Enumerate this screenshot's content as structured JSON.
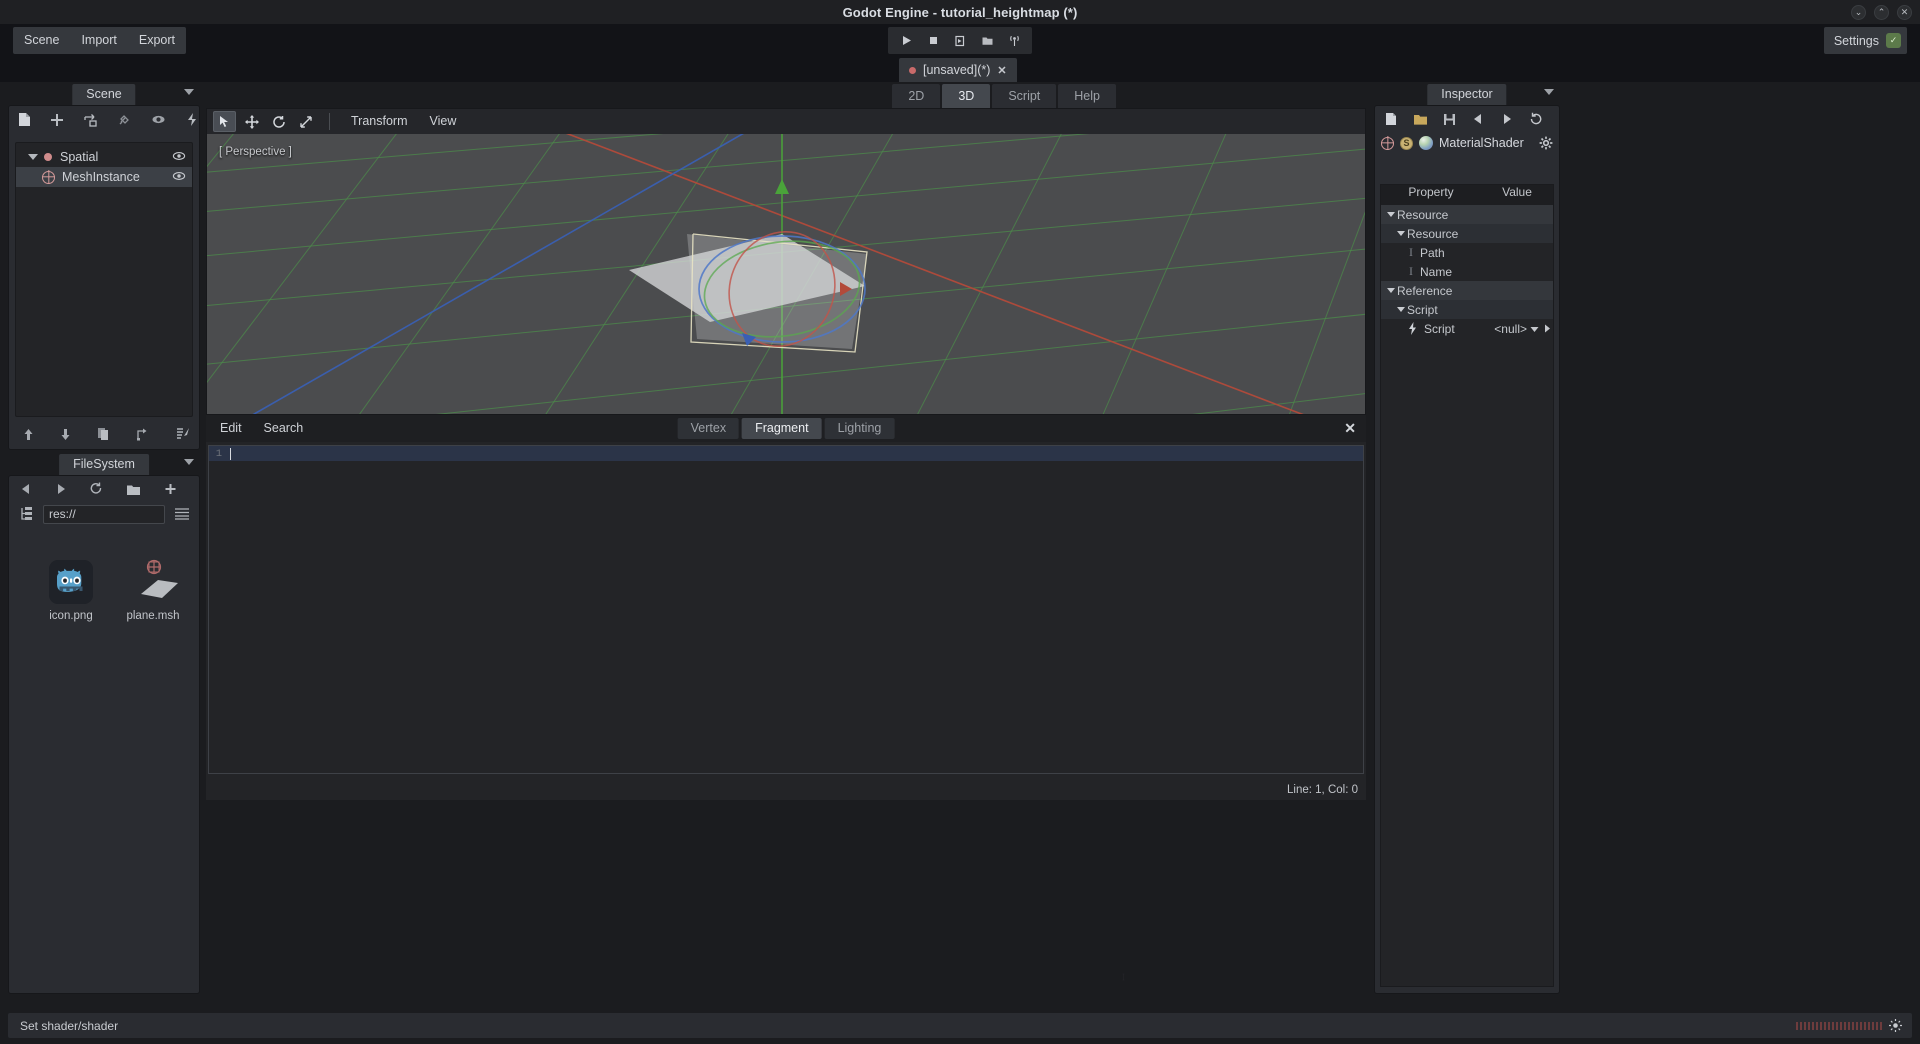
{
  "window": {
    "title": "Godot Engine - tutorial_heightmap (*)",
    "controls": [
      {
        "name": "minimize",
        "glyph": "⌄"
      },
      {
        "name": "maximize",
        "glyph": "⌃"
      },
      {
        "name": "close",
        "glyph": "✕"
      }
    ]
  },
  "menubar": {
    "items": [
      {
        "label": "Scene"
      },
      {
        "label": "Import"
      },
      {
        "label": "Export"
      }
    ],
    "playbar": [
      {
        "name": "play-scene-button",
        "icon": "play-icon"
      },
      {
        "name": "stop-button",
        "icon": "stop-icon"
      },
      {
        "name": "play-current-scene-button",
        "icon": "play-current-icon"
      },
      {
        "name": "play-custom-scene-button",
        "icon": "play-custom-icon"
      },
      {
        "name": "remote-debug-button",
        "icon": "broadcast-icon"
      }
    ],
    "settings": {
      "label": "Settings",
      "badge": "✓"
    }
  },
  "scene_tabs": [
    {
      "label": "[unsaved](*)",
      "modified": true,
      "close": "✕"
    }
  ],
  "scene_dock": {
    "tab_label": "Scene",
    "toolbar": [
      {
        "name": "new-scene-icon"
      },
      {
        "name": "add-node-icon"
      },
      {
        "name": "instance-scene-icon"
      },
      {
        "name": "attach-script-icon"
      },
      {
        "name": "visibility-icon"
      },
      {
        "name": "signals-icon"
      }
    ],
    "tree": [
      {
        "label": "Spatial",
        "depth": 0,
        "type": "root",
        "selected": false,
        "visible_toggle": true
      },
      {
        "label": "MeshInstance",
        "depth": 1,
        "type": "mesh",
        "selected": true,
        "visible_toggle": true
      }
    ],
    "bottom_toolbar": [
      {
        "name": "move-up-icon"
      },
      {
        "name": "move-down-icon"
      },
      {
        "name": "duplicate-icon"
      },
      {
        "name": "reparent-icon"
      },
      {
        "name": "edit-script-icon"
      },
      {
        "name": "delete-icon"
      }
    ]
  },
  "filesystem_dock": {
    "tab_label": "FileSystem",
    "toolbar": [
      {
        "name": "back-icon"
      },
      {
        "name": "forward-icon"
      },
      {
        "name": "refresh-icon"
      },
      {
        "name": "new-folder-icon"
      },
      {
        "name": "add-icon"
      },
      {
        "name": "options-icon"
      }
    ],
    "path_value": "res://",
    "path_placeholder": "res://",
    "files": [
      {
        "name": "icon.png",
        "type": "image"
      },
      {
        "name": "plane.msh",
        "type": "mesh"
      }
    ]
  },
  "viewport": {
    "view_tabs": [
      {
        "label": "2D",
        "active": false
      },
      {
        "label": "3D",
        "active": true
      },
      {
        "label": "Script",
        "active": false
      },
      {
        "label": "Help",
        "active": false
      }
    ],
    "toolbar_tools": [
      {
        "name": "select-mode-button",
        "active": true
      },
      {
        "name": "move-mode-button",
        "active": false
      },
      {
        "name": "rotate-mode-button",
        "active": false
      },
      {
        "name": "scale-mode-button",
        "active": false
      }
    ],
    "toolbar_menus": [
      {
        "label": "Transform"
      },
      {
        "label": "View"
      }
    ],
    "perspective_label": "[ Perspective ]"
  },
  "shader_editor": {
    "menus": [
      {
        "label": "Edit"
      },
      {
        "label": "Search"
      }
    ],
    "tabs": [
      {
        "label": "Vertex",
        "active": false
      },
      {
        "label": "Fragment",
        "active": true
      },
      {
        "label": "Lighting",
        "active": false
      }
    ],
    "close_glyph": "✕",
    "code_lines": [
      {
        "number": "1",
        "text": ""
      }
    ],
    "status": "Line: 1, Col: 0"
  },
  "inspector": {
    "tab_label": "Inspector",
    "toolbar": [
      {
        "name": "new-resource-icon"
      },
      {
        "name": "open-resource-icon"
      },
      {
        "name": "save-resource-icon"
      },
      {
        "name": "back-icon"
      },
      {
        "name": "forward-icon"
      },
      {
        "name": "history-icon"
      }
    ],
    "resource_name": "MaterialShader",
    "resource_settings_icon": "gear-icon",
    "columns": {
      "property": "Property",
      "value": "Value"
    },
    "rows": [
      {
        "label": "Resource",
        "value": "",
        "kind": "category",
        "depth": 0,
        "expanded": true
      },
      {
        "label": "Resource",
        "value": "",
        "kind": "subcategory",
        "depth": 1,
        "expanded": true
      },
      {
        "label": "Path",
        "value": "",
        "kind": "field",
        "depth": 2,
        "icon": "text-field-icon"
      },
      {
        "label": "Name",
        "value": "",
        "kind": "field",
        "depth": 2,
        "icon": "text-field-icon"
      },
      {
        "label": "Reference",
        "value": "",
        "kind": "category",
        "depth": 0,
        "expanded": true
      },
      {
        "label": "Script",
        "value": "",
        "kind": "subcategory",
        "depth": 1,
        "expanded": true
      },
      {
        "label": "Script",
        "value": "<null>",
        "kind": "field",
        "depth": 2,
        "icon": "script-icon",
        "has_dropdown": true
      }
    ]
  },
  "statusbar": {
    "message": "Set shader/shader"
  },
  "colors": {
    "accent_blue": "#2b3448",
    "panel_bg": "#2a2c31",
    "dark_bg": "#232427",
    "titlebar_bg": "#1f2023",
    "viewport_bg": "#4b4c4e",
    "grid_green": "#4c8c4a",
    "axis_red": "#b34a3a",
    "axis_blue": "#3a5fb3",
    "axis_green": "#4aa33a",
    "modified_dot": "#c96a6a"
  }
}
